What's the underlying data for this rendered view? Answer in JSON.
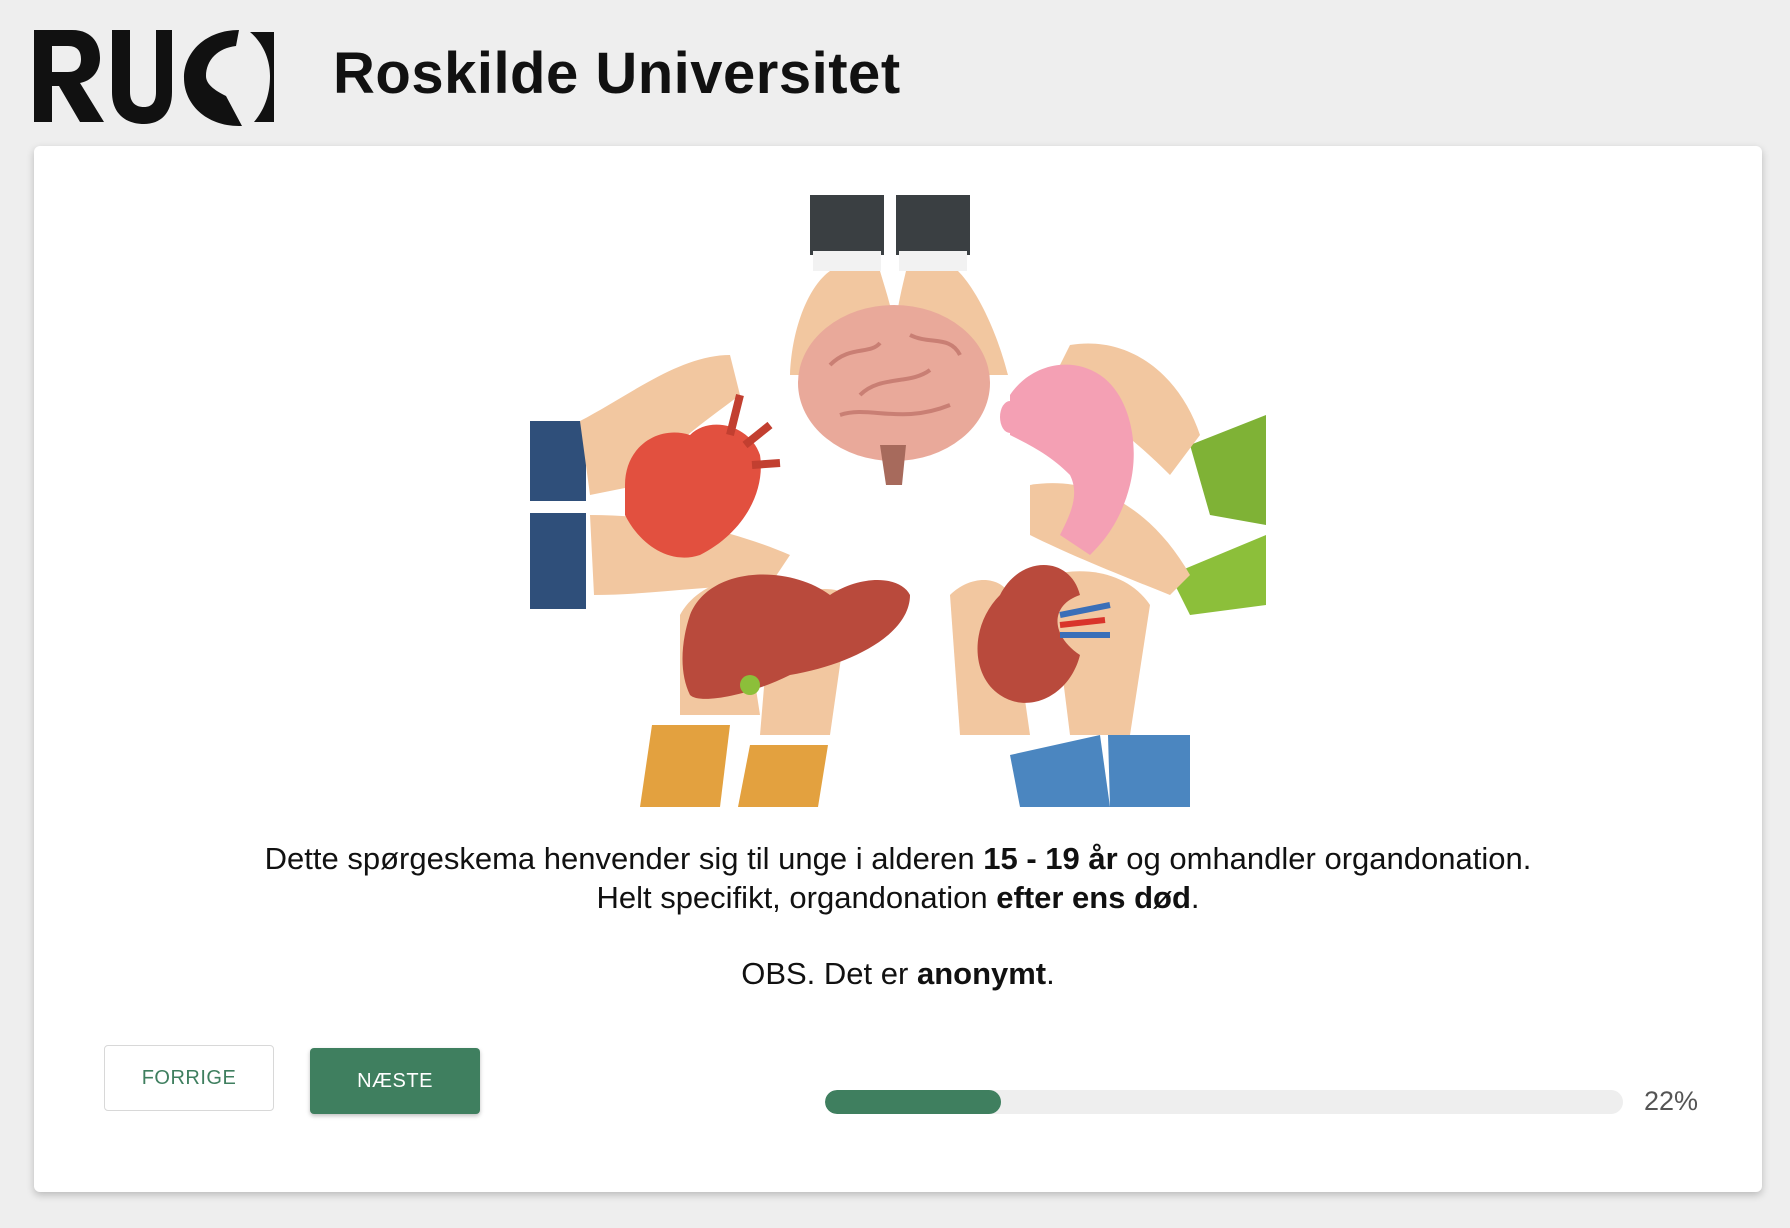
{
  "header": {
    "title": "Roskilde Universitet"
  },
  "intro": {
    "line1_pre": "Dette spørgeskema henvender sig til unge i alderen ",
    "line1_bold": "15 - 19 år",
    "line1_post": " og omhandler organdonation.",
    "line2_pre": "Helt specifikt, organdonation ",
    "line2_bold": "efter ens død",
    "line2_post": ".",
    "line3_pre": "OBS. Det er ",
    "line3_bold": "anonymt",
    "line3_post": "."
  },
  "nav": {
    "prev_label": "FORRIGE",
    "next_label": "NÆSTE"
  },
  "progress": {
    "value": 0.22,
    "label": "22%"
  },
  "illustration": {
    "icons": [
      "heart-icon",
      "brain-icon",
      "stomach-icon",
      "liver-icon",
      "kidney-icon",
      "hand-icon"
    ]
  },
  "colors": {
    "accent": "#3f7f5f",
    "background": "#eeeeee",
    "card": "#ffffff"
  }
}
